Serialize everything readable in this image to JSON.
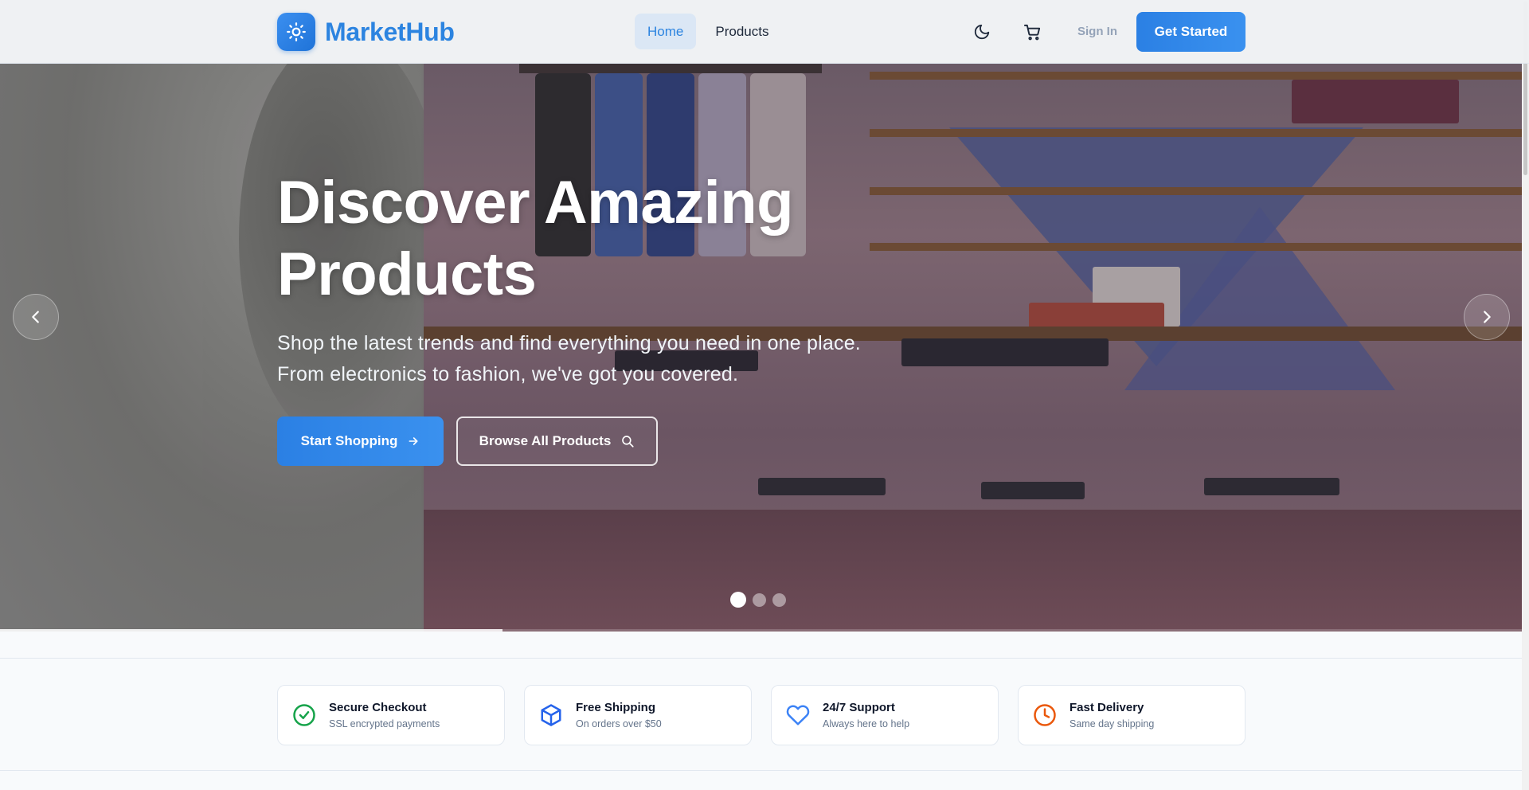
{
  "header": {
    "brand": "MarketHub",
    "nav": [
      {
        "label": "Home",
        "active": true
      },
      {
        "label": "Products",
        "active": false
      }
    ],
    "icons": [
      "moon-icon",
      "cart-icon"
    ],
    "sign_in": "Sign In",
    "get_started": "Get Started"
  },
  "hero": {
    "title_line1": "Discover Amazing",
    "title_line2": "Products",
    "subtitle_line1": "Shop the latest trends and find everything you need in one place.",
    "subtitle_line2": "From electronics to fashion, we've got you covered.",
    "primary_cta": "Start Shopping",
    "secondary_cta": "Browse All Products",
    "slides": 3,
    "active_slide": 1,
    "slide_progress": 0.33
  },
  "features": [
    {
      "title": "Secure Checkout",
      "desc": "SSL encrypted payments",
      "icon": "check-circle-icon",
      "color": "#16a34a"
    },
    {
      "title": "Free Shipping",
      "desc": "On orders over $50",
      "icon": "package-icon",
      "color": "#2563eb"
    },
    {
      "title": "24/7 Support",
      "desc": "Always here to help",
      "icon": "heart-icon",
      "color": "#3b82f6"
    },
    {
      "title": "Fast Delivery",
      "desc": "Same day shipping",
      "icon": "clock-icon",
      "color": "#ea580c"
    }
  ],
  "colors": {
    "accent": "#2c84e0",
    "nav_active_bg": "#dbe7f5"
  }
}
